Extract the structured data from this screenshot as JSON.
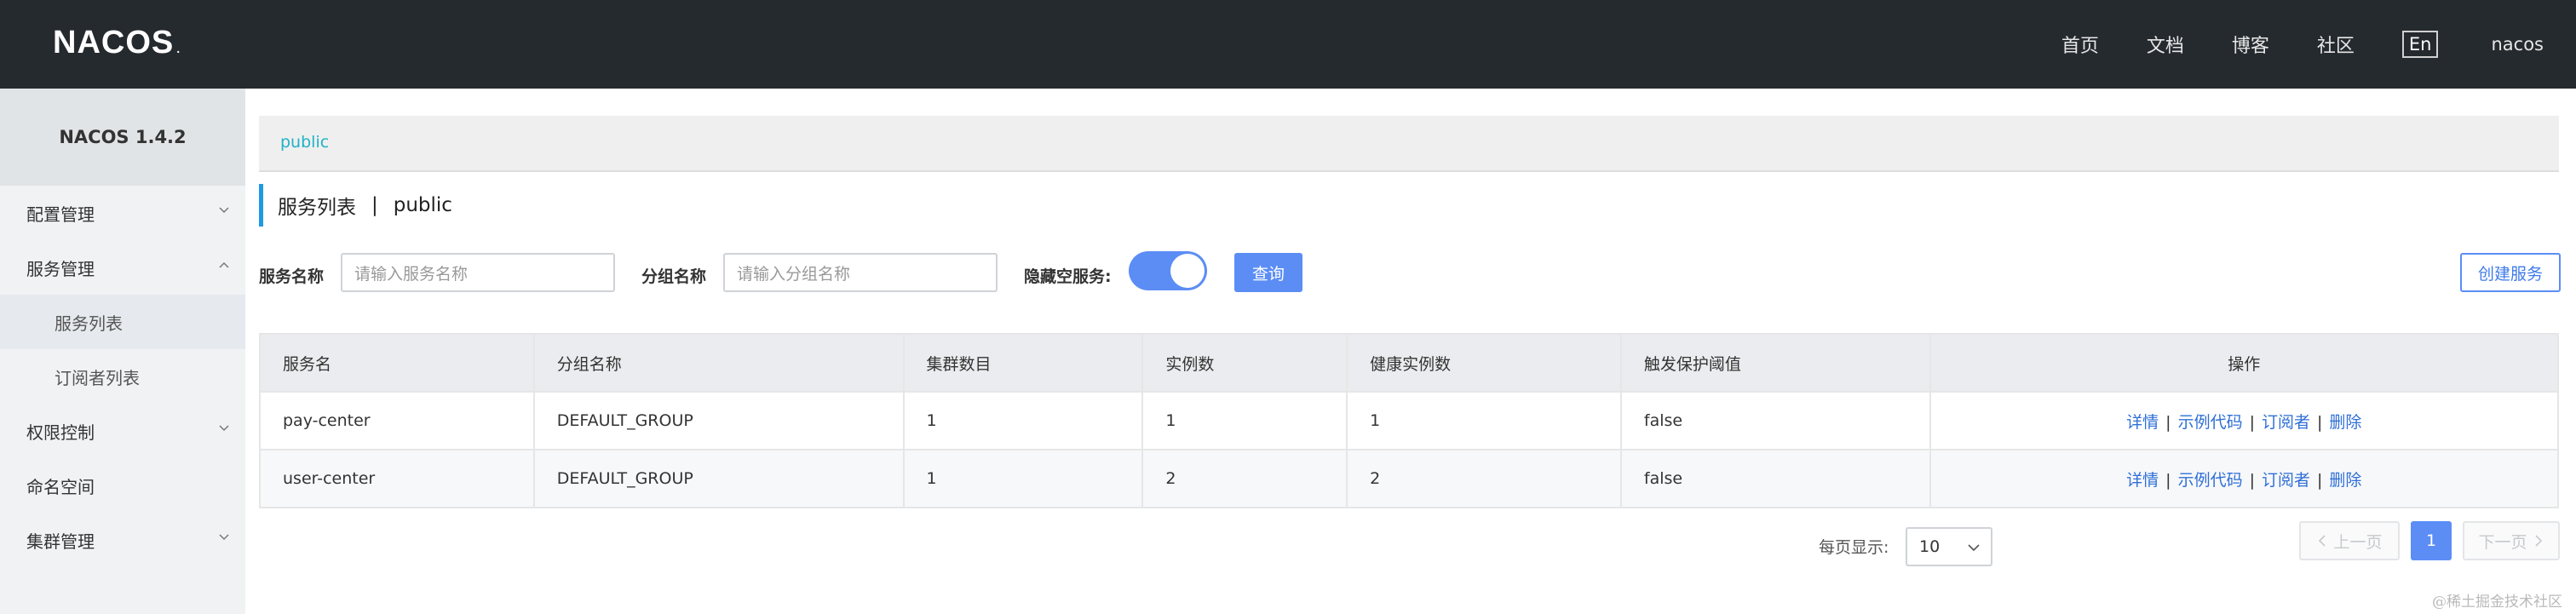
{
  "header": {
    "logo": "NACOS",
    "logo_dot": ".",
    "nav": [
      "首页",
      "文档",
      "博客",
      "社区"
    ],
    "lang": "En",
    "user": "nacos"
  },
  "sidebar": {
    "version": "NACOS 1.4.2",
    "items": [
      {
        "label": "配置管理",
        "icon": "chevron-down-icon"
      },
      {
        "label": "服务管理",
        "icon": "chevron-up-icon"
      },
      {
        "label": "服务列表",
        "sub": true,
        "active": true
      },
      {
        "label": "订阅者列表",
        "sub": true
      },
      {
        "label": "权限控制",
        "icon": "chevron-down-icon"
      },
      {
        "label": "命名空间"
      },
      {
        "label": "集群管理",
        "icon": "chevron-down-icon"
      }
    ]
  },
  "main": {
    "namespace_tab": "public",
    "title": "服务列表",
    "title_sep": "|",
    "title_ns": "public",
    "filters": {
      "service_name_label": "服务名称",
      "service_name_placeholder": "请输入服务名称",
      "group_name_label": "分组名称",
      "group_name_placeholder": "请输入分组名称",
      "hide_empty_label": "隐藏空服务:",
      "hide_empty_on": true,
      "query_label": "查询",
      "create_label": "创建服务"
    },
    "table": {
      "headers": [
        "服务名",
        "分组名称",
        "集群数目",
        "实例数",
        "健康实例数",
        "触发保护阈值",
        "操作"
      ],
      "rows": [
        {
          "name": "pay-center",
          "group": "DEFAULT_GROUP",
          "clusters": "1",
          "instances": "1",
          "healthy": "1",
          "threshold": "false"
        },
        {
          "name": "user-center",
          "group": "DEFAULT_GROUP",
          "clusters": "1",
          "instances": "2",
          "healthy": "2",
          "threshold": "false"
        }
      ],
      "ops": {
        "detail": "详情",
        "sample": "示例代码",
        "subscribers": "订阅者",
        "delete": "删除",
        "sep": "|"
      }
    },
    "pager": {
      "page_size_label": "每页显示:",
      "page_size": "10",
      "prev": "上一页",
      "current": "1",
      "next": "下一页"
    }
  },
  "watermark": "@稀土掘金技术社区",
  "colors": {
    "header_bg": "#252a2f",
    "accent": "#5b8df5",
    "link": "#2f6fd6",
    "namespace": "#1fb2c6"
  }
}
